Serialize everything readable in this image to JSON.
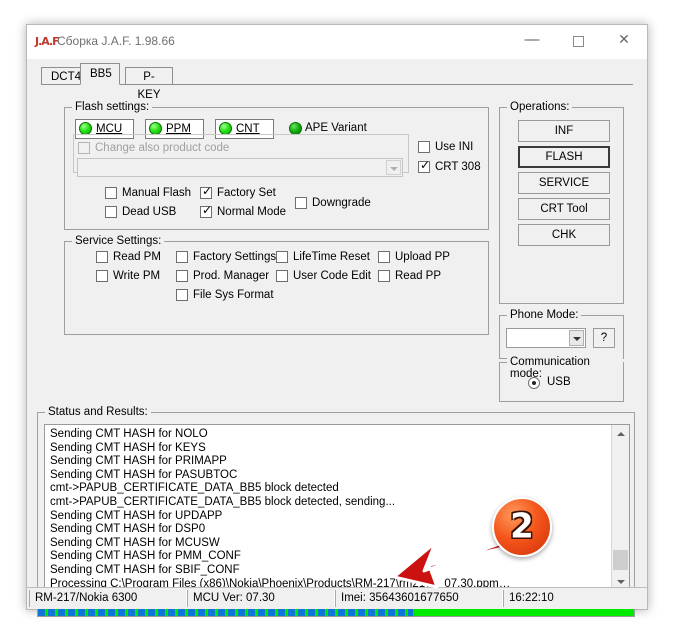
{
  "window": {
    "title": "Сборка J.A.F.  1.98.66",
    "icon": "app-icon",
    "minimize_label": "—",
    "maximize_label": "□",
    "close_label": "✕"
  },
  "tabs": [
    {
      "label": "DCT4",
      "selected": false
    },
    {
      "label": "BB5",
      "selected": true
    },
    {
      "label": "P-KEY",
      "selected": false
    }
  ],
  "flash_settings": {
    "legend": "Flash settings:",
    "indicators": [
      {
        "label": "MCU",
        "boxed": true,
        "state": "on"
      },
      {
        "label": "PPM",
        "boxed": true,
        "state": "on"
      },
      {
        "label": "CNT",
        "boxed": true,
        "state": "on"
      },
      {
        "label": "APE Variant",
        "boxed": false,
        "state": "on-dark"
      }
    ],
    "change_product_code": {
      "label": "Change also product code",
      "checked": false,
      "enabled": false
    },
    "product_code_combo": {
      "value": "",
      "enabled": false
    },
    "right_checks": [
      {
        "label": "Use INI",
        "checked": false
      },
      {
        "label": "CRT 308",
        "checked": true
      }
    ],
    "bottom_checks": [
      {
        "label": "Manual Flash",
        "checked": false
      },
      {
        "label": "Dead USB",
        "checked": false
      },
      {
        "label": "Factory Set",
        "checked": true
      },
      {
        "label": "Normal Mode",
        "checked": true
      },
      {
        "label": "Downgrade",
        "checked": false
      }
    ]
  },
  "service_settings": {
    "legend": "Service Settings:",
    "columns": [
      [
        {
          "label": "Read PM",
          "checked": false
        },
        {
          "label": "Write PM",
          "checked": false
        }
      ],
      [
        {
          "label": "Factory Settings",
          "checked": false
        },
        {
          "label": "Prod. Manager",
          "checked": false
        },
        {
          "label": "File Sys Format",
          "checked": false
        }
      ],
      [
        {
          "label": "LifeTime Reset",
          "checked": false
        },
        {
          "label": "User Code Edit",
          "checked": false
        }
      ],
      [
        {
          "label": "Upload PP",
          "checked": false
        },
        {
          "label": "Read PP",
          "checked": false
        }
      ]
    ]
  },
  "operations": {
    "legend": "Operations:",
    "buttons": [
      {
        "label": "INF",
        "default": false
      },
      {
        "label": "FLASH",
        "default": true
      },
      {
        "label": "SERVICE",
        "default": false
      },
      {
        "label": "CRT Tool",
        "default": false
      },
      {
        "label": "CHK",
        "default": false
      }
    ]
  },
  "phone_mode": {
    "legend": "Phone Mode:",
    "value": "",
    "help_label": "?"
  },
  "communication_mode": {
    "legend": "Communication mode:",
    "options": [
      {
        "label": "USB",
        "selected": true
      }
    ]
  },
  "status_results": {
    "legend": "Status and Results:",
    "lines": [
      "Sending CMT HASH for NOLO",
      "Sending CMT HASH for KEYS",
      "Sending CMT HASH for PRIMAPP",
      "Sending CMT HASH for PASUBTOC",
      "cmt->PAPUB_CERTIFICATE_DATA_BB5 block detected",
      "cmt->PAPUB_CERTIFICATE_DATA_BB5 block detected, sending...",
      "Sending CMT HASH for UPDAPP",
      "Sending CMT HASH for DSP0",
      "Sending CMT HASH for MCUSW",
      "Sending CMT HASH for PMM_CONF",
      "Sending CMT HASH for SBIF_CONF",
      "Processing C:\\Program Files (x86)\\Nokia\\Phoenix\\Products\\RM-217\\rm217__07.30.ppm…"
    ]
  },
  "progress": {
    "percent": 63,
    "fill_color": "#0f76d8",
    "track_color": "#00ea00"
  },
  "status_bar": {
    "cells": [
      "RM-217/Nokia 6300",
      "MCU Ver: 07.30",
      "Imei: 35643601677650",
      "16:22:10"
    ]
  },
  "annotation": {
    "badge_number": "2",
    "badge_color": "#f4561b",
    "arrow_color": "#cc1111",
    "arrow_target": "progress-bar"
  }
}
